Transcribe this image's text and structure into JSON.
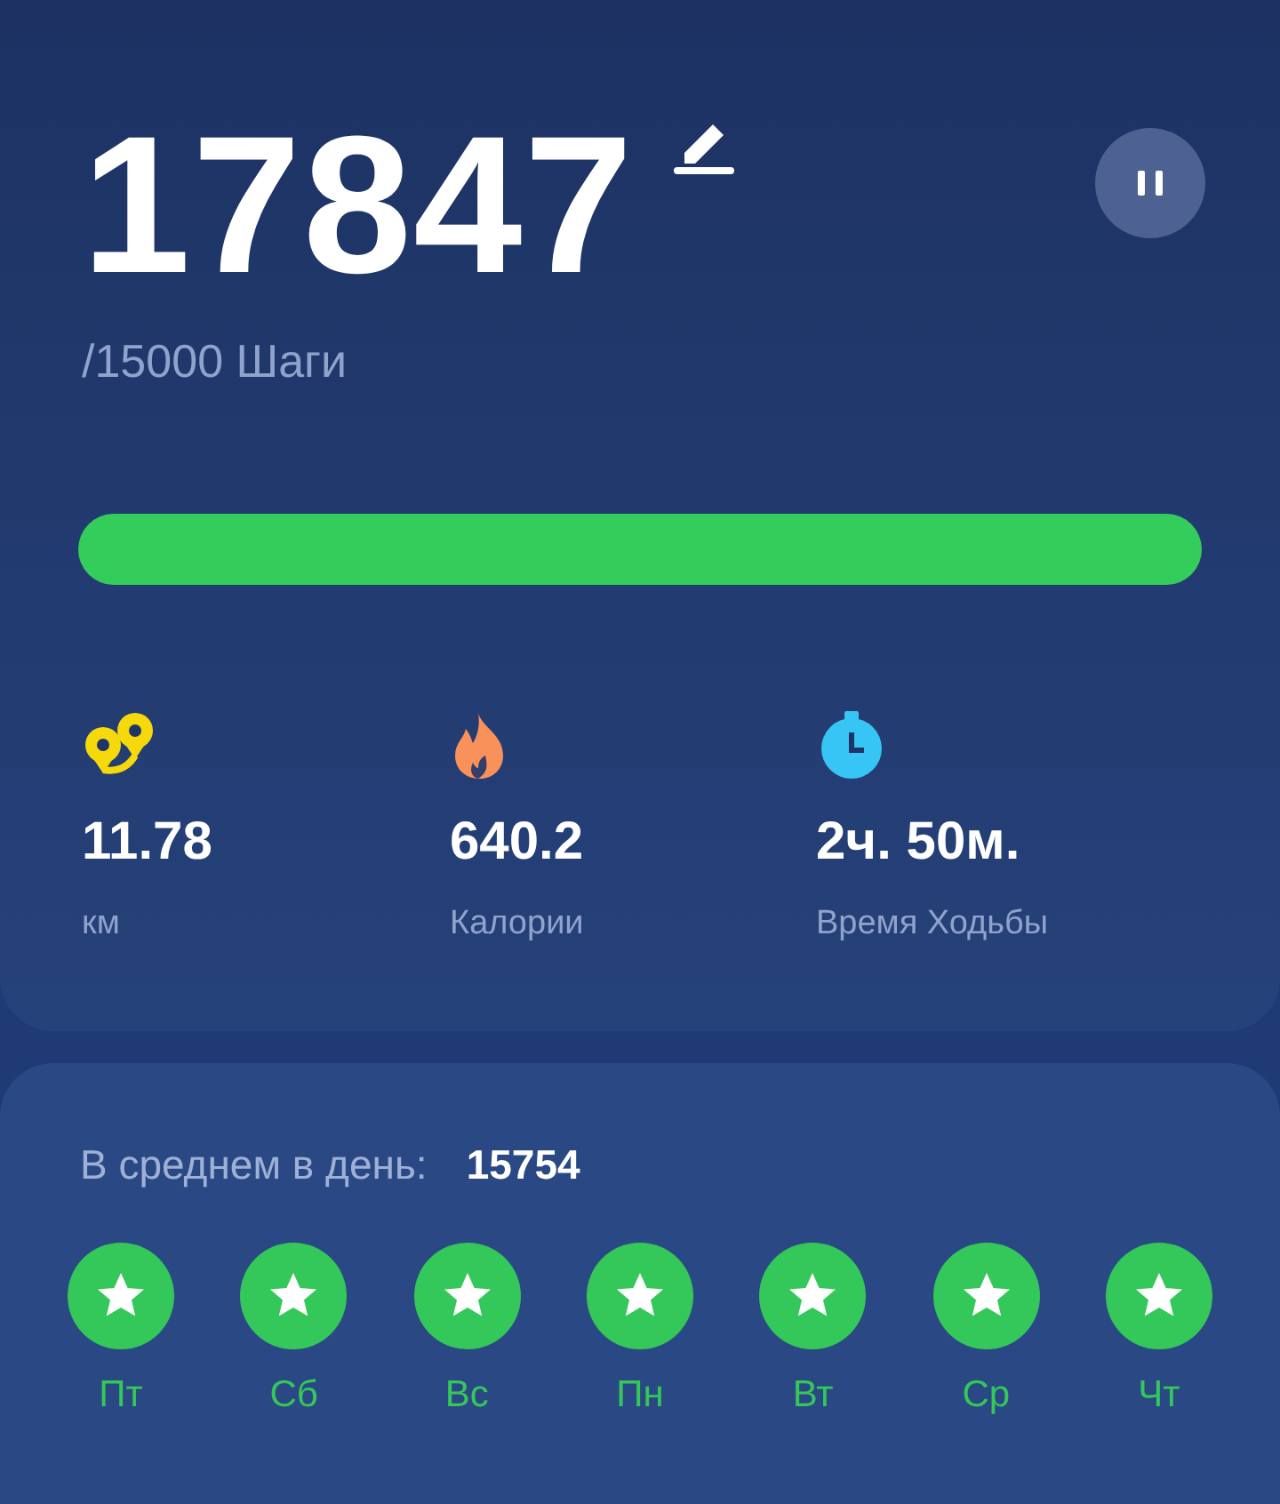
{
  "steps": {
    "value": "17847",
    "goal": "/15000 Шаги",
    "paused": false
  },
  "progress": {
    "level": 1
  },
  "stats": [
    {
      "kind": "distance",
      "value": "11.78",
      "label": "км"
    },
    {
      "kind": "calories",
      "value": "640.2",
      "label": "Калории"
    },
    {
      "kind": "time",
      "value": "2ч. 50м.",
      "label": "Время Ходьбы"
    }
  ],
  "average": {
    "label": "В среднем в день:",
    "value": "15754"
  },
  "days": [
    {
      "label": "Пт",
      "achieved": true
    },
    {
      "label": "Сб",
      "achieved": true
    },
    {
      "label": "Вс",
      "achieved": true
    },
    {
      "label": "Пн",
      "achieved": true
    },
    {
      "label": "Вт",
      "achieved": true
    },
    {
      "label": "Ср",
      "achieved": true
    },
    {
      "label": "Чт",
      "achieved": true
    }
  ]
}
